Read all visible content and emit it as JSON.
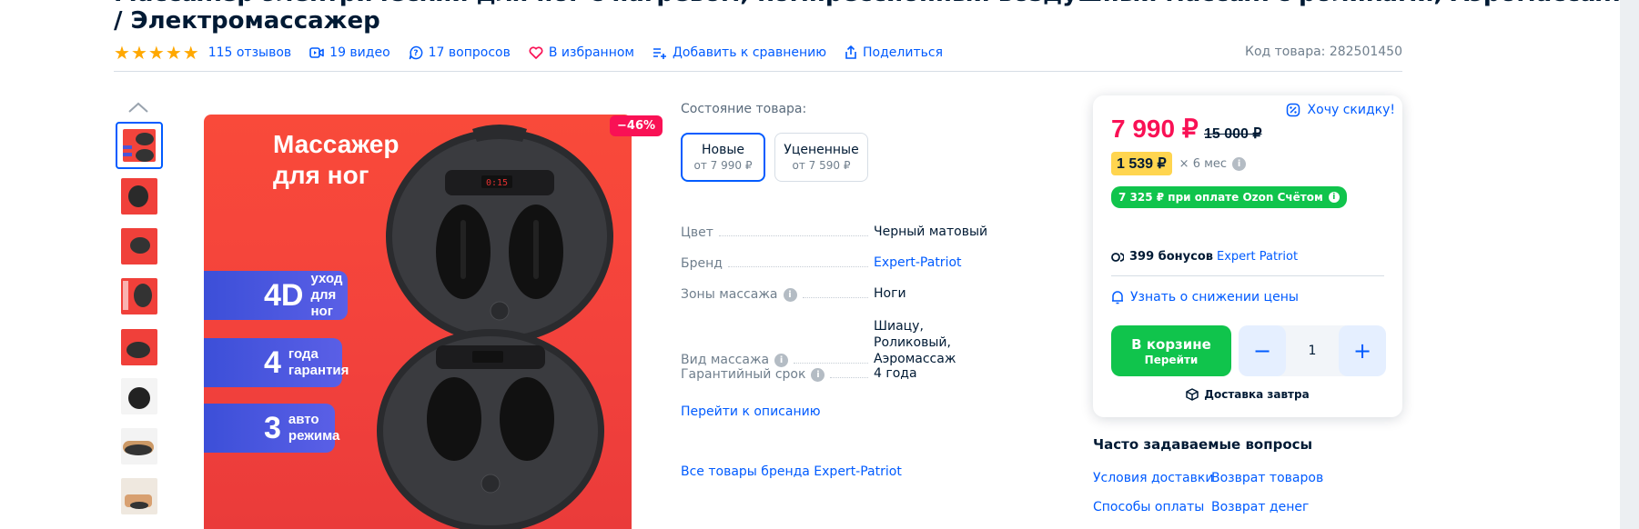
{
  "header": {
    "title_line1": "Массажер электрический для ног с нагревом, компрессионный воздушный массаж с роликами, Аэромассажер",
    "title_line2": "/ Электромассажер",
    "rating_stars": 5,
    "reviews": "115 отзывов",
    "videos": "19 видео",
    "questions": "17 вопросов",
    "favorite": "В избранном",
    "compare": "Добавить к сравнению",
    "share": "Поделиться",
    "sku": "Код товара: 282501450"
  },
  "gallery": {
    "discount": "−46%",
    "image_title": "Массажер\nдля ног",
    "pills": [
      {
        "big": "4D",
        "small": "уход\nдля ног"
      },
      {
        "big": "4",
        "small": "года\nгарантия"
      },
      {
        "big": "3",
        "small": "авто\nрежима"
      }
    ],
    "screen_text": "0:15"
  },
  "condition": {
    "label": "Состояние товара:",
    "options": [
      {
        "title": "Новые",
        "price": "от 7 990 ₽"
      },
      {
        "title": "Уцененные",
        "price": "от 7 590 ₽"
      }
    ]
  },
  "specs": [
    {
      "key": "Цвет",
      "value": "Черный матовый",
      "info": false,
      "link": false
    },
    {
      "key": "Бренд",
      "value": "Expert-Patriot",
      "info": false,
      "link": true
    },
    {
      "key": "Зоны массажа",
      "value": "Ноги",
      "info": true,
      "link": false
    },
    {
      "key": "Вид массажа",
      "value": "Шиацу, Роликовый, Аэромассаж",
      "info": true,
      "link": false
    },
    {
      "key": "Гарантийный срок",
      "value": "4 года",
      "info": true,
      "link": false
    }
  ],
  "links": {
    "goto_description": "Перейти к описанию",
    "all_brand": "Все товары бренда Expert-Patriot"
  },
  "card": {
    "want_discount": "Хочу скидку!",
    "price": "7 990 ₽",
    "old_price": "15 000 ₽",
    "installment_price": "1 539 ₽",
    "installment_term": "× 6 мес",
    "ozon_account": "7 325 ₽ при оплате Ozon Счётом",
    "bonus_amount": "399 бонусов",
    "bonus_brand": "Expert Patriot",
    "price_alert": "Узнать о снижении цены",
    "cart_line1": "В корзине",
    "cart_line2": "Перейти",
    "quantity": "1",
    "minus": "−",
    "plus": "+",
    "delivery": "Доставка завтра"
  },
  "faq": {
    "title": "Часто задаваемые вопросы",
    "links": [
      "Условия доставки",
      "Возврат товаров",
      "Способы оплаты",
      "Возврат денег"
    ]
  },
  "colors": {
    "accent": "#005bff",
    "price": "#f91155",
    "green": "#10c44c",
    "star": "#ffa800",
    "image_bg": "#f94a3a"
  }
}
